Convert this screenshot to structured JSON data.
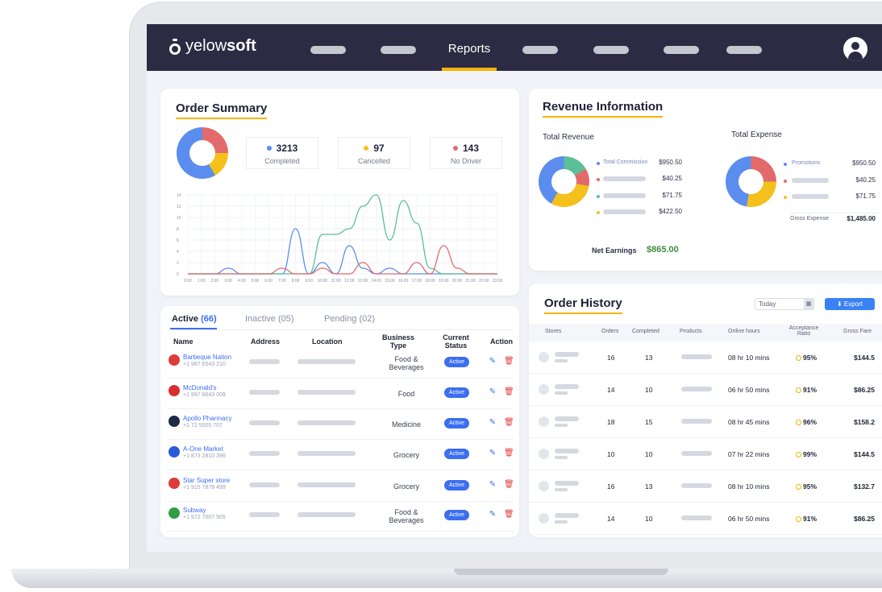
{
  "brand": {
    "name_light": "yelow",
    "name_bold": "soft"
  },
  "nav": {
    "active": "Reports"
  },
  "order_summary": {
    "title": "Order Summary",
    "stats": [
      {
        "value": "3213",
        "label": "Completed",
        "color": "#5b8def"
      },
      {
        "value": "97",
        "label": "Cancelled",
        "color": "#f4c01b"
      },
      {
        "value": "143",
        "label": "No Driver",
        "color": "#e36a6a"
      }
    ],
    "chart_data": {
      "type": "line",
      "x": [
        "0:00",
        "1:00",
        "2:00",
        "3:00",
        "4:00",
        "5:00",
        "6:00",
        "7:00",
        "8:00",
        "9:00",
        "10:00",
        "11:00",
        "12:00",
        "13:00",
        "14:00",
        "15:00",
        "16:00",
        "17:00",
        "18:00",
        "19:00",
        "20:00",
        "21:00",
        "22:00",
        "23:00"
      ],
      "ylim": [
        0,
        14
      ],
      "yticks": [
        "0",
        "2",
        "4",
        "6",
        "8",
        "10",
        "12",
        "14"
      ],
      "grid": true,
      "series": [
        {
          "color": "#5b8def",
          "values": [
            0,
            0,
            0,
            1,
            0,
            0,
            0,
            0,
            8,
            0,
            2,
            0,
            5,
            1,
            0,
            1,
            0,
            0,
            0,
            0,
            0,
            0,
            0,
            0
          ]
        },
        {
          "color": "#5bbf97",
          "values": [
            0,
            0,
            0,
            0,
            0,
            0,
            0,
            0,
            0,
            0,
            7,
            7,
            8,
            12,
            14,
            6,
            13,
            9,
            1,
            0,
            0,
            0,
            0,
            0
          ]
        },
        {
          "color": "#e36a6a",
          "values": [
            0,
            0,
            0,
            0,
            0,
            0,
            0,
            1,
            0,
            0,
            1,
            0,
            0,
            2,
            0,
            0,
            0,
            2,
            0,
            5,
            1,
            0,
            0,
            0
          ]
        }
      ]
    }
  },
  "tabs": [
    {
      "label": "Active",
      "count": "(66)"
    },
    {
      "label": "Inactive",
      "count": "(05)"
    },
    {
      "label": "Pending",
      "count": "(02)"
    }
  ],
  "store_table": {
    "headers": {
      "name": "Name",
      "address": "Address",
      "location": "Location",
      "btype": "Business Type",
      "status": "Current Status",
      "action": "Action"
    },
    "rows": [
      {
        "name": "Barbeque Nation",
        "phone": "+1 987 6543 210",
        "type": "Food & Beverages",
        "status": "Active",
        "logo_color": "#e03b3b"
      },
      {
        "name": "McDonald's",
        "phone": "+1 997 8643 009",
        "type": "Food",
        "status": "Active",
        "logo_color": "#d62f2f"
      },
      {
        "name": "Apollo Pharmacy",
        "phone": "+1 72 5005 707",
        "type": "Medicine",
        "status": "Active",
        "logo_color": "#1f2a44"
      },
      {
        "name": "A-One Market",
        "phone": "+1 873 2810 396",
        "type": "Grocery",
        "status": "Active",
        "logo_color": "#2a5bd7"
      },
      {
        "name": "Star Super store",
        "phone": "+1 915 7878 499",
        "type": "Grocery",
        "status": "Active",
        "logo_color": "#e03b3b"
      },
      {
        "name": "Subway",
        "phone": "+1 972 7007 505",
        "type": "Food & Beverages",
        "status": "Active",
        "logo_color": "#2f9e44"
      }
    ]
  },
  "revenue": {
    "title": "Revenue Information",
    "total_revenue": {
      "label": "Total Revenue",
      "items": [
        {
          "text": "Total Commission",
          "value": "$950.50",
          "color": "#5b8def"
        },
        {
          "text": "",
          "value": "$40.25",
          "color": "#e36a6a"
        },
        {
          "text": "",
          "value": "$71.75",
          "color": "#5bbf97"
        },
        {
          "text": "",
          "value": "$422.50",
          "color": "#f4c01b"
        }
      ]
    },
    "total_expense": {
      "label": "Total Expense",
      "items": [
        {
          "text": "Promotions",
          "value": "$950.50",
          "color": "#5b8def"
        },
        {
          "text": "",
          "value": "$40.25",
          "color": "#e36a6a"
        },
        {
          "text": "",
          "value": "$71.75",
          "color": "#f4c01b"
        }
      ],
      "gross_label": "Gross Expense",
      "gross_value": "$1,485.00"
    },
    "net_label": "Net Earnings",
    "net_value": "$865.00"
  },
  "order_history": {
    "title": "Order History",
    "date_value": "Today",
    "export_label": "Export",
    "headers": {
      "stores": "Stores",
      "orders": "Orders",
      "completed": "Completed",
      "products": "Products",
      "online": "Online hours",
      "acceptance": "Acceptance Ratio",
      "fare": "Gross Fare"
    },
    "rows": [
      {
        "orders": "16",
        "completed": "13",
        "online": "08 hr 10 mins",
        "ratio": "95%",
        "fare": "$144.5"
      },
      {
        "orders": "14",
        "completed": "10",
        "online": "06 hr 50 mins",
        "ratio": "91%",
        "fare": "$86.25"
      },
      {
        "orders": "18",
        "completed": "15",
        "online": "08 hr 45 mins",
        "ratio": "96%",
        "fare": "$158.2"
      },
      {
        "orders": "10",
        "completed": "10",
        "online": "07 hr 22 mins",
        "ratio": "99%",
        "fare": "$144.5"
      },
      {
        "orders": "16",
        "completed": "13",
        "online": "08 hr 10 mins",
        "ratio": "95%",
        "fare": "$132.7"
      },
      {
        "orders": "14",
        "completed": "10",
        "online": "06 hr 50 mins",
        "ratio": "91%",
        "fare": "$86.25"
      }
    ]
  }
}
